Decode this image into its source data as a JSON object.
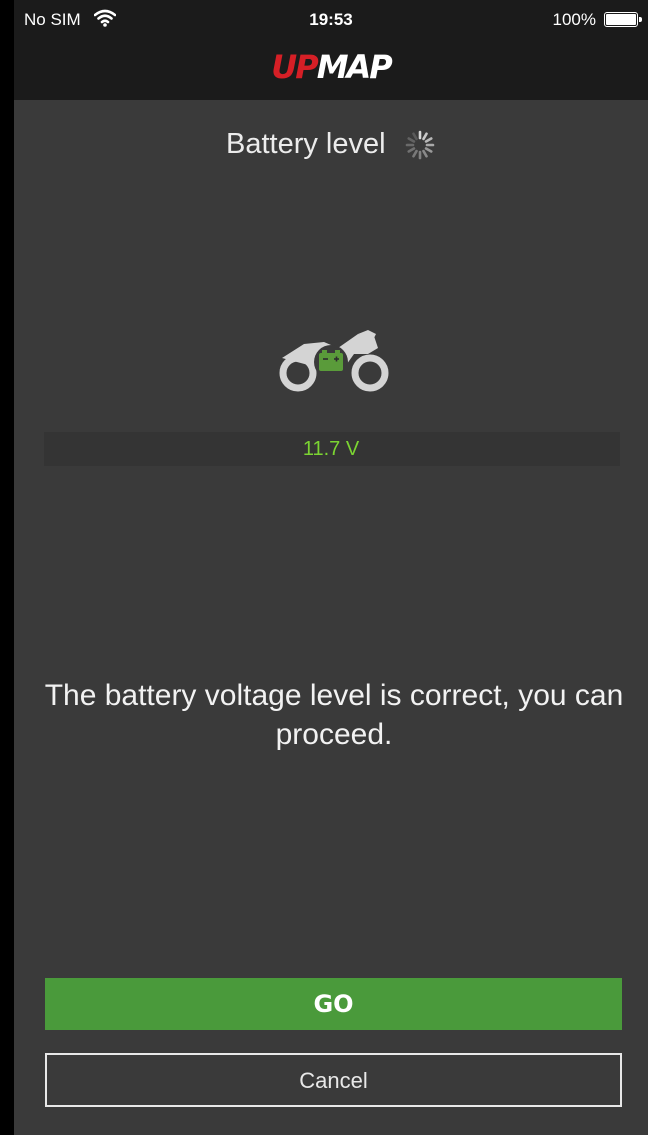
{
  "status_bar": {
    "carrier": "No SIM",
    "time": "19:53",
    "battery_pct": "100%"
  },
  "header": {
    "logo_up": "UP",
    "logo_map": "MAP"
  },
  "page": {
    "title": "Battery level"
  },
  "battery": {
    "voltage": "11.7 V"
  },
  "message": "The battery voltage level is correct, you can proceed.",
  "buttons": {
    "go": "GO",
    "cancel": "Cancel"
  },
  "colors": {
    "accent_green": "#4a9a3b",
    "voltage_green": "#7bd432",
    "brand_red": "#d61f26",
    "background": "#3a3a3a"
  },
  "icons": [
    "wifi-icon",
    "battery-icon",
    "loading-spinner-icon",
    "motorcycle-battery-icon"
  ]
}
